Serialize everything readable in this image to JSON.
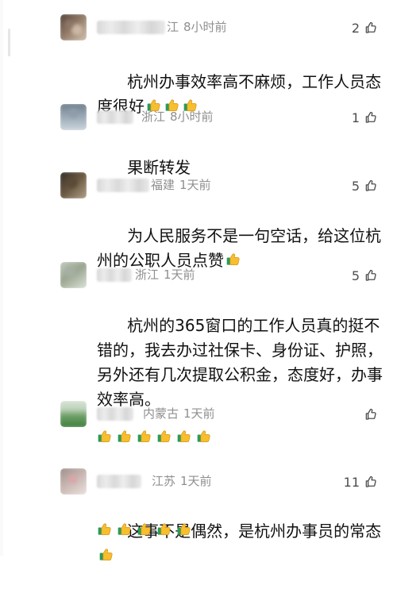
{
  "colors": {
    "background": "#ffffff",
    "meta_text": "#8f8f8f",
    "body_text": "#111111",
    "emoji_yellow": "#f7be2e",
    "emoji_green": "#2c9a5a"
  },
  "comments": [
    {
      "location": "江",
      "time": "8小时前",
      "likes": "2",
      "text": "杭州办事效率高不麻烦，工作人员态度很好",
      "emoji": "thumbs-up-emoji",
      "emoji_count": 3
    },
    {
      "location": "浙江",
      "time": "8小时前",
      "likes": "1",
      "text": "果断转发"
    },
    {
      "location": "福建",
      "time": "1天前",
      "likes": "5",
      "text": "为人民服务不是一句空话，给这位杭州的公职人员点赞",
      "emoji": "thumbs-up-emoji",
      "emoji_count": 1
    },
    {
      "location": "浙江",
      "time": "1天前",
      "likes": "5",
      "text": "杭州的365窗口的工作人员真的挺不错的，我去办过社保卡、身份证、护照，另外还有几次提取公积金，态度好，办事效率高。"
    },
    {
      "location": "内蒙古",
      "time": "1天前",
      "likes": "",
      "emoji": "thumbs-up-emoji",
      "emoji_count": 6
    },
    {
      "location": "江苏",
      "time": "1天前",
      "likes": "11",
      "text": "这事不是偶然，是杭州办事员的常态",
      "emoji": "thumbs-up-emoji",
      "emoji_count": 1,
      "emoji_line_count": 5
    }
  ]
}
